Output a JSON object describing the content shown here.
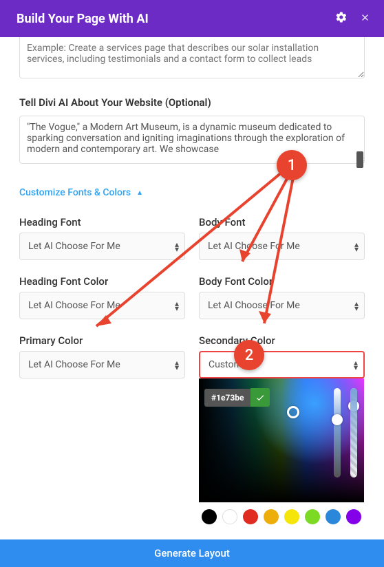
{
  "header": {
    "title": "Build Your Page With AI"
  },
  "prompt": {
    "placeholder": "Example: Create a services page that describes our solar installation services, including testimonials and a contact form to collect leads"
  },
  "about": {
    "label": "Tell Divi AI About Your Website (Optional)",
    "value": "\"The Vogue,\" a Modern Art Museum, is a dynamic museum dedicated to sparking conversation and igniting imaginations through the exploration of modern and contemporary art. We showcase"
  },
  "collapse": {
    "label": "Customize Fonts & Colors"
  },
  "fields": {
    "heading_font": {
      "label": "Heading Font",
      "value": "Let AI Choose For Me"
    },
    "body_font": {
      "label": "Body Font",
      "value": "Let AI Choose For Me"
    },
    "heading_font_color": {
      "label": "Heading Font Color",
      "value": "Let AI Choose For Me"
    },
    "body_font_color": {
      "label": "Body Font Color",
      "value": "Let AI Choose For Me"
    },
    "primary_color": {
      "label": "Primary Color",
      "value": "Let AI Choose For Me"
    },
    "secondary_color": {
      "label": "Secondary Color",
      "value": "Custom"
    }
  },
  "colorpicker": {
    "hex": "#1e73be",
    "swatches": [
      "#000000",
      "#ffffff",
      "#e02b20",
      "#edad0b",
      "#f5e50b",
      "#7cda24",
      "#2b87da",
      "#8300e9"
    ]
  },
  "footer": {
    "button": "Generate Layout"
  },
  "annotations": {
    "one": "1",
    "two": "2"
  }
}
